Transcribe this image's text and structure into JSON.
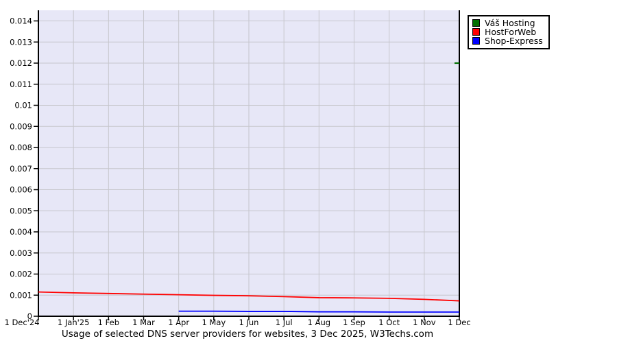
{
  "chart_data": {
    "type": "line",
    "title": "Usage of selected DNS server providers for websites, 3 Dec 2025, W3Techs.com",
    "xlabel": "",
    "ylabel": "",
    "ylim": [
      0,
      0.014
    ],
    "grid": true,
    "legend_position": "top-right-outside",
    "x_tick_labels": [
      "1 Dec'24",
      "1 Jan'25",
      "1 Feb",
      "1 Mar",
      "1 Apr",
      "1 May",
      "1 Jun",
      "1 Jul",
      "1 Aug",
      "1 Sep",
      "1 Oct",
      "1 Nov",
      "1 Dec"
    ],
    "y_tick_labels": [
      "0",
      "0.001",
      "0.002",
      "0.003",
      "0.004",
      "0.005",
      "0.006",
      "0.007",
      "0.008",
      "0.009",
      "0.01",
      "0.011",
      "0.012",
      "0.013",
      "0.014"
    ],
    "series": [
      {
        "name": "Váš Hosting",
        "color": "#007000",
        "values": [
          null,
          null,
          null,
          null,
          null,
          null,
          null,
          null,
          null,
          null,
          null,
          null,
          0.012
        ]
      },
      {
        "name": "HostForWeb",
        "color": "#ff0000",
        "values": [
          0.00115,
          0.00111,
          0.00108,
          0.00105,
          0.00102,
          0.00099,
          0.00097,
          0.00093,
          0.00088,
          0.00087,
          0.00085,
          0.0008,
          0.00073
        ]
      },
      {
        "name": "Shop-Express",
        "color": "#0000ff",
        "values": [
          null,
          null,
          null,
          null,
          0.00024,
          0.00024,
          0.00023,
          0.00023,
          0.00021,
          0.00021,
          0.0002,
          0.0002,
          0.0002
        ]
      }
    ]
  },
  "colors": {
    "plot_bg": "#e7e7f7",
    "grid": "#c6c6cc",
    "axis": "#000000"
  }
}
